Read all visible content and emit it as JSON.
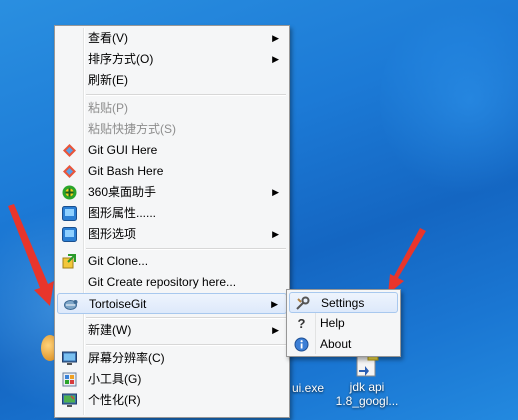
{
  "menu": {
    "items": [
      {
        "label": "查看(V)",
        "submenu": "▶"
      },
      {
        "label": "排序方式(O)",
        "submenu": "▶"
      },
      {
        "label": "刷新(E)"
      },
      {
        "label": "粘贴(P)"
      },
      {
        "label": "粘贴快捷方式(S)"
      },
      {
        "label": "Git GUI Here"
      },
      {
        "label": "Git Bash Here"
      },
      {
        "label": "360桌面助手",
        "submenu": "▶"
      },
      {
        "label": "图形属性......"
      },
      {
        "label": "图形选项",
        "submenu": "▶"
      },
      {
        "label": "Git Clone..."
      },
      {
        "label": "Git Create repository here..."
      },
      {
        "label": "TortoiseGit",
        "submenu": "▶"
      },
      {
        "label": "新建(W)",
        "submenu": "▶"
      },
      {
        "label": "屏幕分辨率(C)"
      },
      {
        "label": "小工具(G)"
      },
      {
        "label": "个性化(R)"
      }
    ]
  },
  "submenu": {
    "items": [
      {
        "label": "Settings"
      },
      {
        "label": "Help"
      },
      {
        "label": "About"
      }
    ]
  },
  "desktop": {
    "icons": [
      {
        "label": "ui.exe"
      },
      {
        "label": "jdk api 1.8_googl..."
      }
    ]
  },
  "colors": {
    "desktop_blue": "#1c7ad6",
    "arrow_red": "#e8352b",
    "highlight": "#dde9fb"
  }
}
